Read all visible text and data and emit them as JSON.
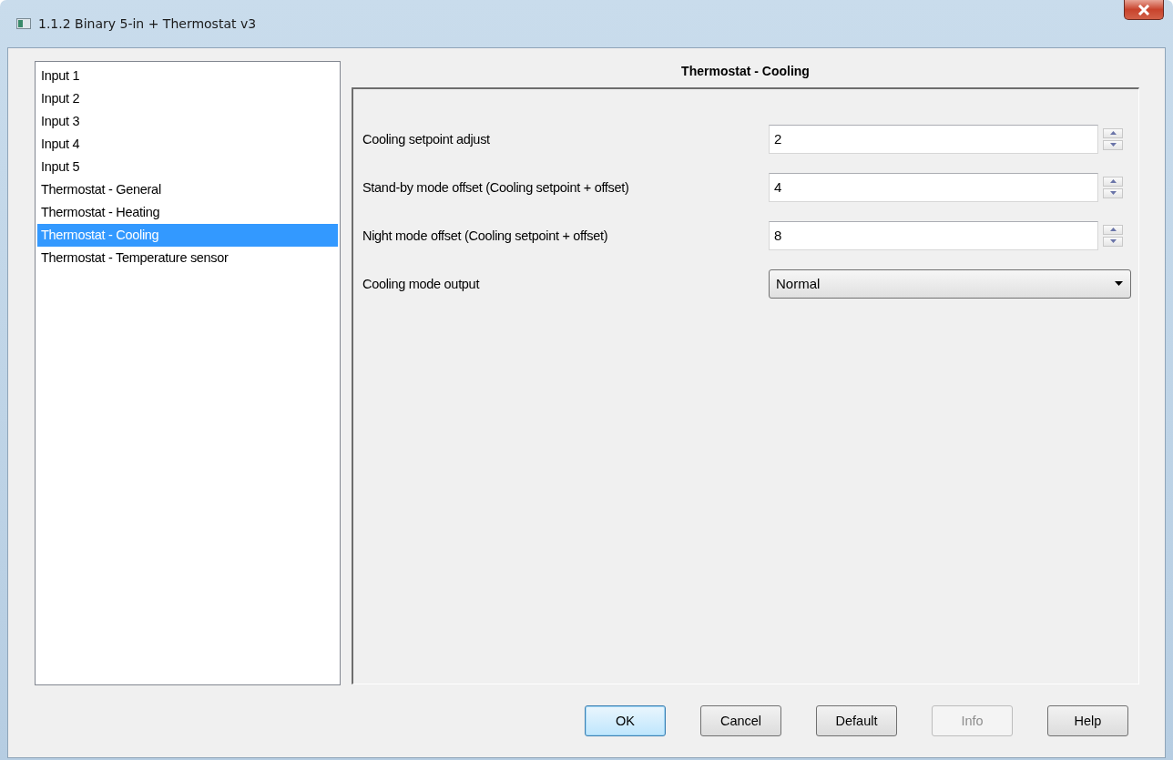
{
  "window": {
    "title": "1.1.2 Binary 5-in + Thermostat v3"
  },
  "sidebar": {
    "items": [
      {
        "label": "Input 1",
        "selected": false
      },
      {
        "label": "Input 2",
        "selected": false
      },
      {
        "label": "Input 3",
        "selected": false
      },
      {
        "label": "Input 4",
        "selected": false
      },
      {
        "label": "Input 5",
        "selected": false
      },
      {
        "label": "Thermostat - General",
        "selected": false
      },
      {
        "label": "Thermostat - Heating",
        "selected": false
      },
      {
        "label": "Thermostat - Cooling",
        "selected": true
      },
      {
        "label": "Thermostat - Temperature sensor",
        "selected": false
      }
    ]
  },
  "panel": {
    "title": "Thermostat - Cooling",
    "fields": [
      {
        "kind": "spin",
        "label": "Cooling setpoint adjust",
        "value": "2"
      },
      {
        "kind": "spin",
        "label": "Stand-by mode offset (Cooling setpoint + offset)",
        "value": "4"
      },
      {
        "kind": "spin",
        "label": "Night mode offset (Cooling setpoint + offset)",
        "value": "8"
      },
      {
        "kind": "dropdown",
        "label": "Cooling mode output",
        "value": "Normal"
      }
    ]
  },
  "buttons": [
    {
      "label": "OK",
      "default": true,
      "disabled": false
    },
    {
      "label": "Cancel",
      "default": false,
      "disabled": false
    },
    {
      "label": "Default",
      "default": false,
      "disabled": false
    },
    {
      "label": "Info",
      "default": false,
      "disabled": true
    },
    {
      "label": "Help",
      "default": false,
      "disabled": false
    }
  ]
}
